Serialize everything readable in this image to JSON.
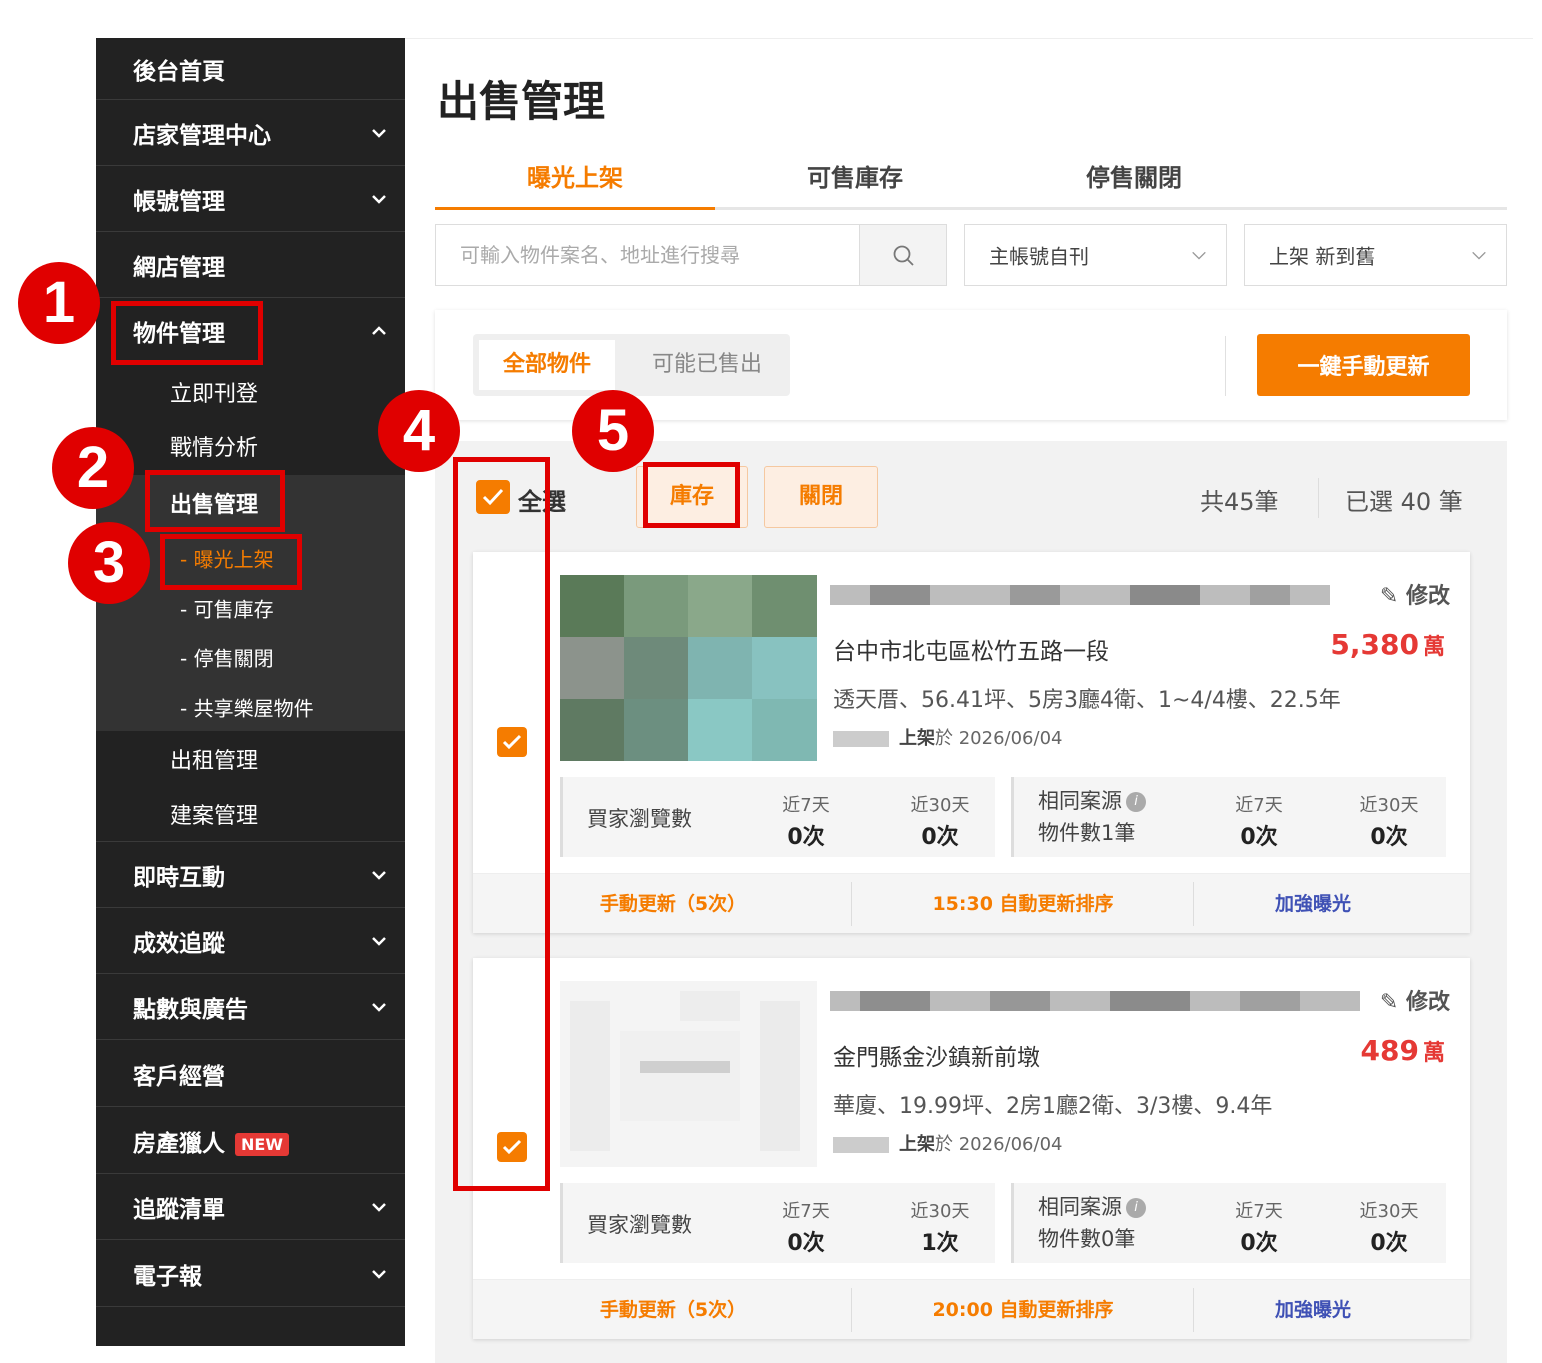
{
  "sidebar": {
    "home": "後台首頁",
    "store_center": "店家管理中心",
    "account": "帳號管理",
    "web_store": "網店管理",
    "property_mgmt": "物件管理",
    "post_now": "立即刊登",
    "analysis": "戰情分析",
    "sale_mgmt": "出售管理",
    "sub_exposed": "- 曝光上架",
    "sub_stock": "- 可售庫存",
    "sub_closed": "- 停售關閉",
    "sub_shared": "- 共享樂屋物件",
    "rent_mgmt": "出租管理",
    "build_mgmt": "建案管理",
    "interaction": "即時互動",
    "tracking": "成效追蹤",
    "points_ads": "點數與廣告",
    "customers": "客戶經營",
    "hunter": "房產獵人",
    "hunter_badge": "NEW",
    "watchlist": "追蹤清單",
    "newsletter": "電子報"
  },
  "page": {
    "title": "出售管理"
  },
  "tabs": [
    "曝光上架",
    "可售庫存",
    "停售關閉"
  ],
  "search": {
    "placeholder": "可輸入物件案名、地址進行搜尋",
    "icon": "search-icon"
  },
  "filters": {
    "account": "主帳號自刊",
    "sort": "上架 新到舊"
  },
  "segment": {
    "all": "全部物件",
    "maybe_sold": "可能已售出"
  },
  "refresh_button": "一鍵手動更新",
  "bulk": {
    "select_all": "全選",
    "stock_btn": "庫存",
    "close_btn": "關閉",
    "total": "共45筆",
    "selected": "已選 40 筆"
  },
  "listings": [
    {
      "edit": "修改",
      "address": "台中市北屯區松竹五路一段",
      "price": "5,380",
      "unit": "萬",
      "info": "透天厝、56.41坪、5房3廳4衛、1~4/4樓、22.5年",
      "posted_label": "上架",
      "posted_date": "於 2026/06/04",
      "views_label": "買家瀏覽數",
      "d7_label": "近7天",
      "d30_label": "近30天",
      "views_7": "0次",
      "views_30": "0次",
      "same_label": "相同案源",
      "same_count": "物件數1筆",
      "same_7": "0次",
      "same_30": "0次",
      "act_manual": "手動更新（5次）",
      "act_auto": "15:30 自動更新排序",
      "act_boost": "加強曝光"
    },
    {
      "edit": "修改",
      "address": "金門縣金沙鎮新前墩",
      "price": "489",
      "unit": "萬",
      "info": "華廈、19.99坪、2房1廳2衛、3/3樓、9.4年",
      "posted_label": "上架",
      "posted_date": "於 2026/06/04",
      "views_label": "買家瀏覽數",
      "d7_label": "近7天",
      "d30_label": "近30天",
      "views_7": "0次",
      "views_30": "1次",
      "same_label": "相同案源",
      "same_count": "物件數0筆",
      "same_7": "0次",
      "same_30": "0次",
      "act_manual": "手動更新（5次）",
      "act_auto": "20:00 自動更新排序",
      "act_boost": "加強曝光"
    }
  ],
  "annotations": [
    "1",
    "2",
    "3",
    "4",
    "5"
  ],
  "colors": {
    "accent": "#f57c00",
    "price": "#e53935",
    "sidebar_bg": "#222222",
    "highlight": "#e00000",
    "boost_link": "#3f51b5"
  }
}
